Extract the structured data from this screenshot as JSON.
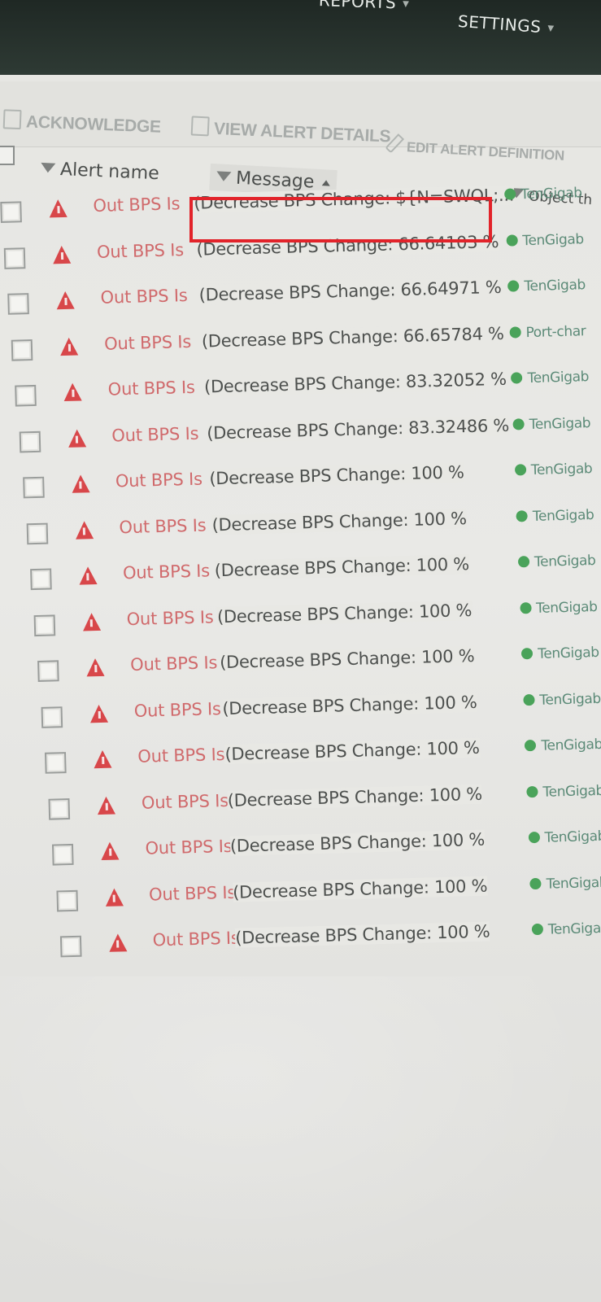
{
  "nav": {
    "reports": "REPORTS",
    "settings": "SETTINGS"
  },
  "toolbar": {
    "acknowledge": "ACKNOWLEDGE",
    "view_alert_details": "VIEW ALERT DETAILS",
    "edit_alert_definition": "EDIT ALERT DEFINITION"
  },
  "columns": {
    "alert_name": "Alert name",
    "message": "Message",
    "object": "Object th"
  },
  "rows": [
    {
      "alert_name": "Out BPS Is",
      "message": "(Decrease BPS Change: ${N=SWQL;...",
      "object": "TenGigab"
    },
    {
      "alert_name": "Out BPS Is",
      "message": "(Decrease BPS Change: 66.64103 %",
      "object": "TenGigab"
    },
    {
      "alert_name": "Out BPS Is",
      "message": "(Decrease BPS Change: 66.64971 %",
      "object": "TenGigab"
    },
    {
      "alert_name": "Out BPS Is",
      "message": "(Decrease BPS Change: 66.65784 %",
      "object": "Port-char"
    },
    {
      "alert_name": "Out BPS Is",
      "message": "(Decrease BPS Change: 83.32052 %",
      "object": "TenGigab"
    },
    {
      "alert_name": "Out BPS Is",
      "message": "(Decrease BPS Change: 83.32486 %",
      "object": "TenGigab"
    },
    {
      "alert_name": "Out BPS Is",
      "message": "(Decrease BPS Change: 100 %",
      "object": "TenGigab"
    },
    {
      "alert_name": "Out BPS Is",
      "message": "(Decrease BPS Change: 100 %",
      "object": "TenGigab"
    },
    {
      "alert_name": "Out BPS Is",
      "message": "(Decrease BPS Change: 100 %",
      "object": "TenGigab"
    },
    {
      "alert_name": "Out BPS Is",
      "message": "(Decrease BPS Change: 100 %",
      "object": "TenGigab"
    },
    {
      "alert_name": "Out BPS Is",
      "message": "(Decrease BPS Change: 100 %",
      "object": "TenGigab"
    },
    {
      "alert_name": "Out BPS Is",
      "message": "(Decrease BPS Change: 100 %",
      "object": "TenGigab"
    },
    {
      "alert_name": "Out BPS Is",
      "message": "(Decrease BPS Change: 100 %",
      "object": "TenGigab"
    },
    {
      "alert_name": "Out BPS Is",
      "message": "(Decrease BPS Change: 100 %",
      "object": "TenGigab"
    },
    {
      "alert_name": "Out BPS Is",
      "message": "(Decrease BPS Change: 100 %",
      "object": "TenGigab"
    },
    {
      "alert_name": "Out BPS Is",
      "message": "(Decrease BPS Change: 100 %",
      "object": "TenGigab"
    },
    {
      "alert_name": "Out BPS Is",
      "message": "(Decrease BPS Change: 100 %",
      "object": "TenGigab"
    }
  ],
  "colors": {
    "highlight": "#e2232a",
    "alert_red": "#d8474a",
    "status_green": "#4aa35a"
  }
}
